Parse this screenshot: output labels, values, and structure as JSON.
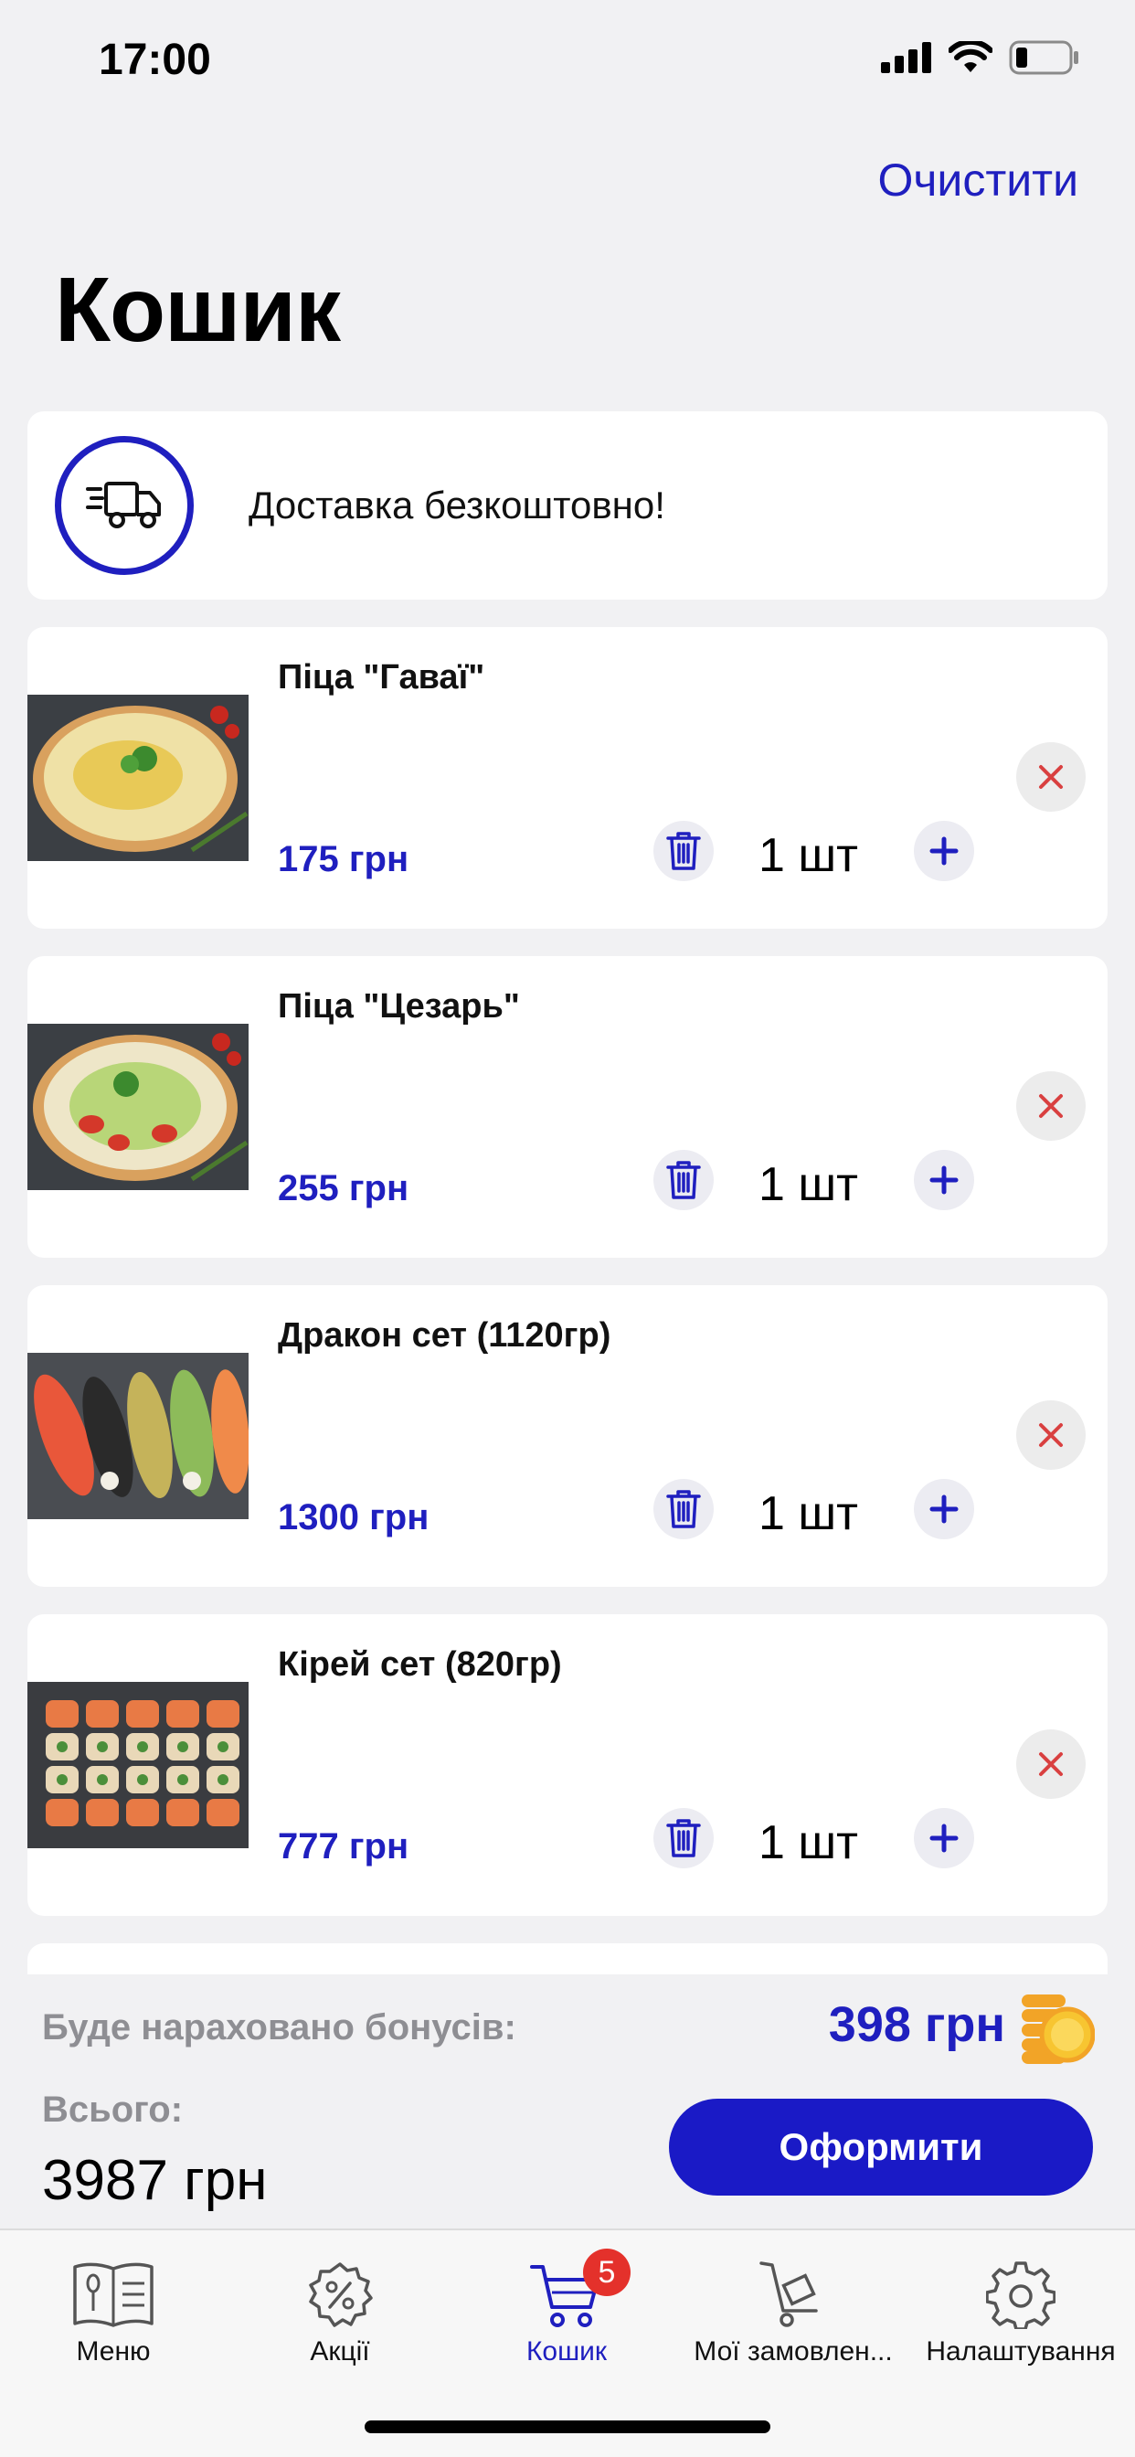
{
  "status_bar": {
    "time": "17:00",
    "icons": [
      "signal-icon",
      "wifi-icon",
      "battery-icon"
    ]
  },
  "header": {
    "clear_label": "Очистити",
    "title": "Кошик"
  },
  "delivery": {
    "text": "Доставка безкоштовно!",
    "icon": "delivery-truck-icon"
  },
  "items": [
    {
      "name": "Піца \"Гаваї\"",
      "price": "175 грн",
      "quantity": "1 шт",
      "image": "pizza-hawaii-image"
    },
    {
      "name": "Піца \"Цезарь\"",
      "price": "255 грн",
      "quantity": "1 шт",
      "image": "pizza-caesar-image"
    },
    {
      "name": "Дракон сет (1120гр)",
      "price": "1300 грн",
      "quantity": "1 шт",
      "image": "dragon-set-image"
    },
    {
      "name": "Кірей сет (820гр)",
      "price": "777 грн",
      "quantity": "1 шт",
      "image": "kirei-set-image"
    }
  ],
  "summary": {
    "bonus_label": "Буде нараховано бонусів:",
    "bonus_value": "398 грн",
    "total_label": "Всього:",
    "total_value": "3987 грн",
    "checkout_label": "Оформити"
  },
  "tab_bar": {
    "tabs": [
      {
        "label": "Меню",
        "icon": "menu-book-icon"
      },
      {
        "label": "Акції",
        "icon": "discount-icon"
      },
      {
        "label": "Кошик",
        "icon": "cart-icon",
        "active": true,
        "badge": "5"
      },
      {
        "label": "Мої замовлен...",
        "icon": "orders-cart-icon"
      },
      {
        "label": "Налаштування",
        "icon": "gear-icon"
      }
    ]
  },
  "colors": {
    "accent": "#1f1fbf",
    "background": "#f1f1f3",
    "badge": "#e4312b",
    "remove": "#d94040"
  }
}
